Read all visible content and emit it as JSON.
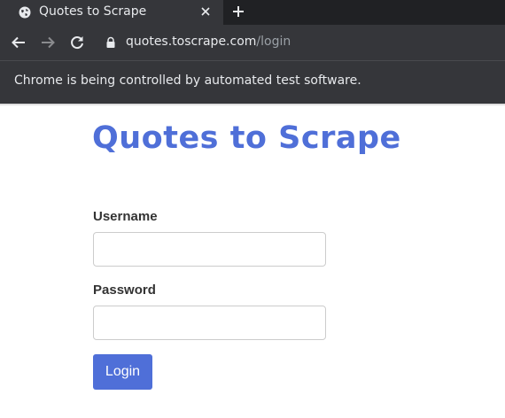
{
  "browser": {
    "tab": {
      "title": "Quotes to Scrape",
      "favicon": "globe-icon"
    },
    "address_bar": {
      "host": "quotes.toscrape.com",
      "path": "/login"
    },
    "infobar": {
      "text": "Chrome is being controlled by automated test software."
    }
  },
  "page": {
    "title": "Quotes to Scrape",
    "form": {
      "username_label": "Username",
      "username_value": "",
      "password_label": "Password",
      "password_value": "",
      "submit_label": "Login"
    }
  },
  "colors": {
    "accent": "#4f6fd8",
    "chrome_dark": "#202124",
    "chrome_toolbar": "#35363a"
  }
}
